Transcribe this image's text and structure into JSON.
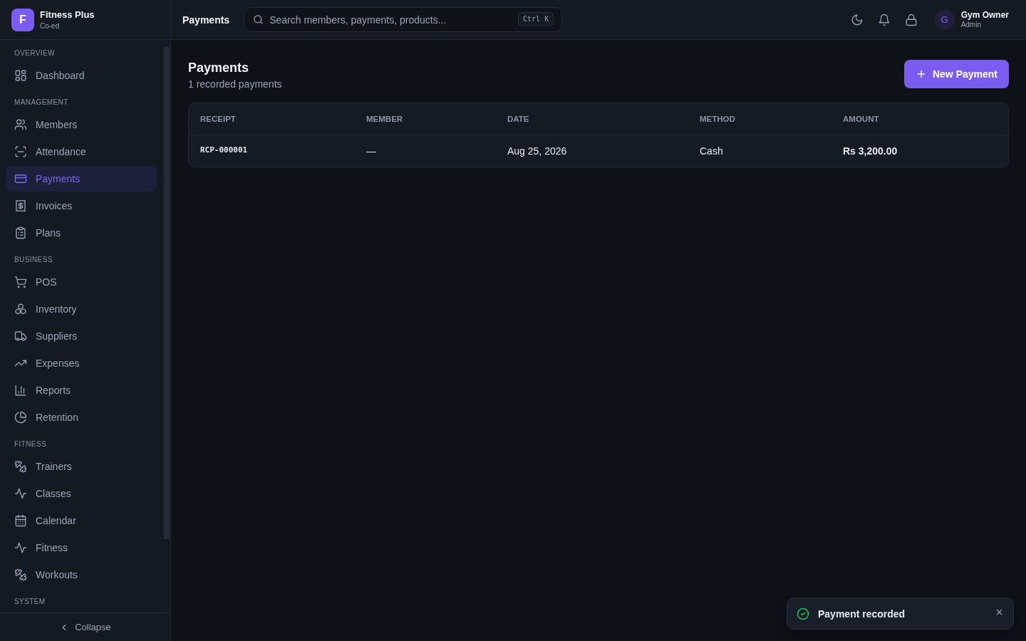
{
  "sidebar": {
    "brand": {
      "logo_letter": "F",
      "name": "Fitness Plus",
      "subtitle": "Co-ed"
    },
    "sections": [
      {
        "label": "OVERVIEW",
        "items": [
          {
            "label": "Dashboard",
            "selected": false
          }
        ]
      },
      {
        "label": "MANAGEMENT",
        "items": [
          {
            "label": "Members",
            "selected": false
          },
          {
            "label": "Attendance",
            "selected": false
          },
          {
            "label": "Payments",
            "selected": true
          },
          {
            "label": "Invoices",
            "selected": false
          },
          {
            "label": "Plans",
            "selected": false
          }
        ]
      },
      {
        "label": "BUSINESS",
        "items": [
          {
            "label": "POS",
            "selected": false
          },
          {
            "label": "Inventory",
            "selected": false
          },
          {
            "label": "Suppliers",
            "selected": false
          },
          {
            "label": "Expenses",
            "selected": false
          },
          {
            "label": "Reports",
            "selected": false
          },
          {
            "label": "Retention",
            "selected": false
          }
        ]
      },
      {
        "label": "FITNESS",
        "items": [
          {
            "label": "Trainers",
            "selected": false
          },
          {
            "label": "Classes",
            "selected": false
          },
          {
            "label": "Calendar",
            "selected": false
          },
          {
            "label": "Fitness",
            "selected": false
          },
          {
            "label": "Workouts",
            "selected": false
          }
        ]
      },
      {
        "label": "SYSTEM"
      }
    ],
    "collapse_button": {
      "label": "Collapse"
    }
  },
  "topbar": {
    "title": "Payments",
    "search": {
      "placeholder": "Search members, payments, products...",
      "shortcut": "Ctrl K"
    },
    "user": {
      "avatar_letter": "G",
      "name": "Gym Owner",
      "role": "Admin"
    }
  },
  "page": {
    "title": "Payments",
    "subtitle": "1 recorded payments",
    "new_button": "New Payment"
  },
  "table": {
    "columns": [
      "RECEIPT",
      "MEMBER",
      "DATE",
      "METHOD",
      "AMOUNT"
    ],
    "rows": [
      {
        "cells": [
          "RCP-000001",
          "—",
          "Aug 25, 2026",
          "Cash",
          "Rs 3,200.00"
        ]
      }
    ]
  },
  "toast": {
    "message": "Payment recorded"
  }
}
